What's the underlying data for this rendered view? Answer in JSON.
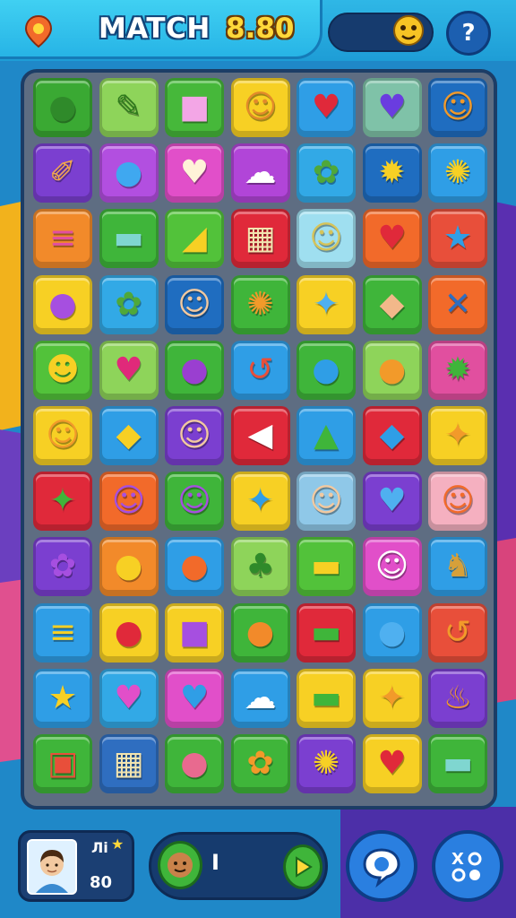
{
  "header": {
    "title": "MATCH",
    "score": "8.80",
    "help_label": "?",
    "icons": [
      "location-icon",
      "mascot-icon",
      "help-icon"
    ]
  },
  "board": {
    "rows": 11,
    "cols": 7,
    "tiles": [
      [
        {
          "color": "#3aa933",
          "glyph": "●",
          "fg": "#2f8a2a",
          "icon": "green-ball-icon"
        },
        {
          "color": "#8ed45a",
          "glyph": "✎",
          "fg": "#2e7a1c",
          "icon": "green-candy-icon"
        },
        {
          "color": "#46b83a",
          "glyph": "■",
          "fg": "#f3a6e6",
          "icon": "pink-cube-icon"
        },
        {
          "color": "#f7d024",
          "glyph": "☺",
          "fg": "#e28a2a",
          "icon": "lion-face-icon"
        },
        {
          "color": "#2f9ee6",
          "glyph": "♥",
          "fg": "#e0293a",
          "icon": "red-heart-icon"
        },
        {
          "color": "#7fc2a8",
          "glyph": "♥",
          "fg": "#6a3ce0",
          "icon": "purple-heart-icon"
        },
        {
          "color": "#1f6dc0",
          "glyph": "☺",
          "fg": "#f29a2a",
          "icon": "orange-face-icon"
        }
      ],
      [
        {
          "color": "#7b3fd0",
          "glyph": "✐",
          "fg": "#f2a84a",
          "icon": "paintbrush-icon"
        },
        {
          "color": "#b24fe0",
          "glyph": "●",
          "fg": "#3fa8f0",
          "icon": "blue-bubble-icon"
        },
        {
          "color": "#e14fc9",
          "glyph": "♥",
          "fg": "#fff3d8",
          "icon": "cream-heart-icon"
        },
        {
          "color": "#b145d8",
          "glyph": "☁",
          "fg": "#ffffff",
          "icon": "ghost-icon"
        },
        {
          "color": "#32a9e6",
          "glyph": "✿",
          "fg": "#4fa83a",
          "icon": "potted-plant-icon"
        },
        {
          "color": "#1f6dc0",
          "glyph": "✹",
          "fg": "#f7d024",
          "icon": "yellow-fish-icon"
        },
        {
          "color": "#2f9ee6",
          "glyph": "✺",
          "fg": "#f7d024",
          "icon": "yellow-bird-icon"
        }
      ],
      [
        {
          "color": "#f28a2a",
          "glyph": "≡",
          "fg": "#e14f9f",
          "icon": "pink-book-icon"
        },
        {
          "color": "#3fb53a",
          "glyph": "▬",
          "fg": "#7fd6d0",
          "icon": "teal-bar-icon"
        },
        {
          "color": "#52c23a",
          "glyph": "◢",
          "fg": "#f7d024",
          "icon": "cheese-icon"
        },
        {
          "color": "#e0293a",
          "glyph": "▦",
          "fg": "#f2e4b0",
          "icon": "crate-icon"
        },
        {
          "color": "#9fdff0",
          "glyph": "☺",
          "fg": "#d6c45a",
          "icon": "moon-face-icon"
        },
        {
          "color": "#f26a2a",
          "glyph": "♥",
          "fg": "#e0293a",
          "icon": "red-heart-2-icon"
        },
        {
          "color": "#e84f3a",
          "glyph": "★",
          "fg": "#2f9ee6",
          "icon": "blue-star-icon"
        }
      ],
      [
        {
          "color": "#f7d024",
          "glyph": "●",
          "fg": "#a64fe0",
          "icon": "purple-bubble-icon"
        },
        {
          "color": "#32a9e6",
          "glyph": "✿",
          "fg": "#4fa83a",
          "icon": "potted-plant-2-icon"
        },
        {
          "color": "#1f6dc0",
          "glyph": "☺",
          "fg": "#f2c9a0",
          "icon": "boy-face-icon"
        },
        {
          "color": "#3fb53a",
          "glyph": "✺",
          "fg": "#f29a2a",
          "icon": "sun-flower-icon"
        },
        {
          "color": "#f7d024",
          "glyph": "✦",
          "fg": "#4fb0f0",
          "icon": "parrot-icon"
        },
        {
          "color": "#3fb53a",
          "glyph": "◆",
          "fg": "#f2b88a",
          "icon": "leaf-icon"
        },
        {
          "color": "#f26a2a",
          "glyph": "✕",
          "fg": "#2f6ec0",
          "icon": "crossed-sticks-icon"
        }
      ],
      [
        {
          "color": "#52c23a",
          "glyph": "☻",
          "fg": "#f7d024",
          "icon": "dog-face-icon"
        },
        {
          "color": "#8ed45a",
          "glyph": "♥",
          "fg": "#e0297a",
          "icon": "pink-heart-icon"
        },
        {
          "color": "#3fb53a",
          "glyph": "●",
          "fg": "#9a3fd0",
          "icon": "purple-ball-icon"
        },
        {
          "color": "#2f9ee6",
          "glyph": "↺",
          "fg": "#e84f3a",
          "icon": "hook-icon"
        },
        {
          "color": "#3fb53a",
          "glyph": "●",
          "fg": "#2f9ee6",
          "icon": "blue-balloon-icon"
        },
        {
          "color": "#8ed45a",
          "glyph": "●",
          "fg": "#f29a2a",
          "icon": "orange-balloon-icon"
        },
        {
          "color": "#e14f9f",
          "glyph": "✹",
          "fg": "#3fb53a",
          "icon": "green-bush-icon"
        }
      ],
      [
        {
          "color": "#f7d024",
          "glyph": "☺",
          "fg": "#f29a2a",
          "icon": "lion-face-2-icon"
        },
        {
          "color": "#2f9ee6",
          "glyph": "◆",
          "fg": "#f7d024",
          "icon": "yellow-gem-icon"
        },
        {
          "color": "#7b3fd0",
          "glyph": "☺",
          "fg": "#f2c9a0",
          "icon": "girl-face-icon"
        },
        {
          "color": "#e0293a",
          "glyph": "◀",
          "fg": "#ffffff",
          "icon": "white-fish-icon"
        },
        {
          "color": "#2f9ee6",
          "glyph": "▲",
          "fg": "#3fb53a",
          "icon": "green-mound-icon"
        },
        {
          "color": "#e0293a",
          "glyph": "◆",
          "fg": "#2f9ee6",
          "icon": "blue-fish-icon"
        },
        {
          "color": "#f7d024",
          "glyph": "✦",
          "fg": "#f29a2a",
          "icon": "orange-bird-icon"
        }
      ],
      [
        {
          "color": "#e0293a",
          "glyph": "✦",
          "fg": "#3fb53a",
          "icon": "green-star-icon"
        },
        {
          "color": "#f26a2a",
          "glyph": "☺",
          "fg": "#a64fe0",
          "icon": "purple-face-icon"
        },
        {
          "color": "#3fb53a",
          "glyph": "☺",
          "fg": "#a64fe0",
          "icon": "purple-box-face-icon"
        },
        {
          "color": "#f7d024",
          "glyph": "✦",
          "fg": "#2f9ee6",
          "icon": "blue-bird-icon"
        },
        {
          "color": "#8fc8e8",
          "glyph": "☺",
          "fg": "#f2c9a0",
          "icon": "boy-face-2-icon"
        },
        {
          "color": "#7b3fd0",
          "glyph": "♥",
          "fg": "#4fb0f0",
          "icon": "blue-heart-icon"
        },
        {
          "color": "#f5b0c0",
          "glyph": "☺",
          "fg": "#f26a2a",
          "icon": "fox-face-icon"
        }
      ],
      [
        {
          "color": "#7b3fd0",
          "glyph": "✿",
          "fg": "#a64fe0",
          "icon": "purple-tree-icon"
        },
        {
          "color": "#f28a2a",
          "glyph": "●",
          "fg": "#f7d024",
          "icon": "yellow-blob-icon"
        },
        {
          "color": "#2f9ee6",
          "glyph": "●",
          "fg": "#f26a2a",
          "icon": "orange-balloon-2-icon"
        },
        {
          "color": "#8ed45a",
          "glyph": "♣",
          "fg": "#2f8a2a",
          "icon": "green-tree-icon"
        },
        {
          "color": "#52c23a",
          "glyph": "▬",
          "fg": "#f7d024",
          "icon": "yellow-bar-icon"
        },
        {
          "color": "#e14fc9",
          "glyph": "☺",
          "fg": "#ffffff",
          "icon": "white-cat-icon"
        },
        {
          "color": "#2f9ee6",
          "glyph": "♞",
          "fg": "#d6a03a",
          "icon": "snail-icon"
        }
      ],
      [
        {
          "color": "#2f9ee6",
          "glyph": "≡",
          "fg": "#f7d024",
          "icon": "layered-cake-icon"
        },
        {
          "color": "#f7d024",
          "glyph": "●",
          "fg": "#e0293a",
          "icon": "apple-icon"
        },
        {
          "color": "#f7d024",
          "glyph": "■",
          "fg": "#a64fe0",
          "icon": "purple-dice-icon"
        },
        {
          "color": "#3fb53a",
          "glyph": "●",
          "fg": "#f28a2a",
          "icon": "pumpkin-icon"
        },
        {
          "color": "#e0293a",
          "glyph": "▬",
          "fg": "#3fb53a",
          "icon": "burger-icon"
        },
        {
          "color": "#2f9ee6",
          "glyph": "●",
          "fg": "#4fb0f0",
          "icon": "blue-ball-icon"
        },
        {
          "color": "#e84f3a",
          "glyph": "↺",
          "fg": "#f29a2a",
          "icon": "orange-hook-icon"
        }
      ],
      [
        {
          "color": "#2f9ee6",
          "glyph": "★",
          "fg": "#f7d024",
          "icon": "gold-star-icon"
        },
        {
          "color": "#32a9e6",
          "glyph": "♥",
          "fg": "#e14fc9",
          "icon": "magenta-heart-icon"
        },
        {
          "color": "#e14fc9",
          "glyph": "♥",
          "fg": "#2f9ee6",
          "icon": "blue-heart-2-icon"
        },
        {
          "color": "#2f9ee6",
          "glyph": "☁",
          "fg": "#ffffff",
          "icon": "ghost-2-icon"
        },
        {
          "color": "#f7d024",
          "glyph": "▬",
          "fg": "#3fb53a",
          "icon": "green-bar-icon"
        },
        {
          "color": "#f7d024",
          "glyph": "✦",
          "fg": "#f29a2a",
          "icon": "orange-bird-2-icon"
        },
        {
          "color": "#7b3fd0",
          "glyph": "♨",
          "fg": "#f29a2a",
          "icon": "hot-cup-icon"
        }
      ],
      [
        {
          "color": "#3fb53a",
          "glyph": "▣",
          "fg": "#e84f3a",
          "icon": "picture-frame-icon"
        },
        {
          "color": "#2f6ec0",
          "glyph": "▦",
          "fg": "#f2e4b0",
          "icon": "crate-2-icon"
        },
        {
          "color": "#3fb53a",
          "glyph": "●",
          "fg": "#e86a8f",
          "icon": "donut-icon"
        },
        {
          "color": "#3fb53a",
          "glyph": "✿",
          "fg": "#f29a2a",
          "icon": "orange-flower-icon"
        },
        {
          "color": "#7b3fd0",
          "glyph": "✺",
          "fg": "#f7d024",
          "icon": "sun-face-icon"
        },
        {
          "color": "#f7d024",
          "glyph": "♥",
          "fg": "#e0293a",
          "icon": "red-heart-3-icon"
        },
        {
          "color": "#3fb53a",
          "glyph": "▬",
          "fg": "#7fd6d0",
          "icon": "teal-bar-2-icon"
        }
      ]
    ]
  },
  "bottom": {
    "level_label": "Лi",
    "level_star": "★",
    "card_score": "80",
    "progress_value": "I",
    "menu_label": "X0\n0●"
  },
  "colors": {
    "background": "#1f88c8",
    "board_background": "#5e6d82",
    "board_border": "#1c3d66",
    "accent_yellow": "#ffd83a"
  }
}
